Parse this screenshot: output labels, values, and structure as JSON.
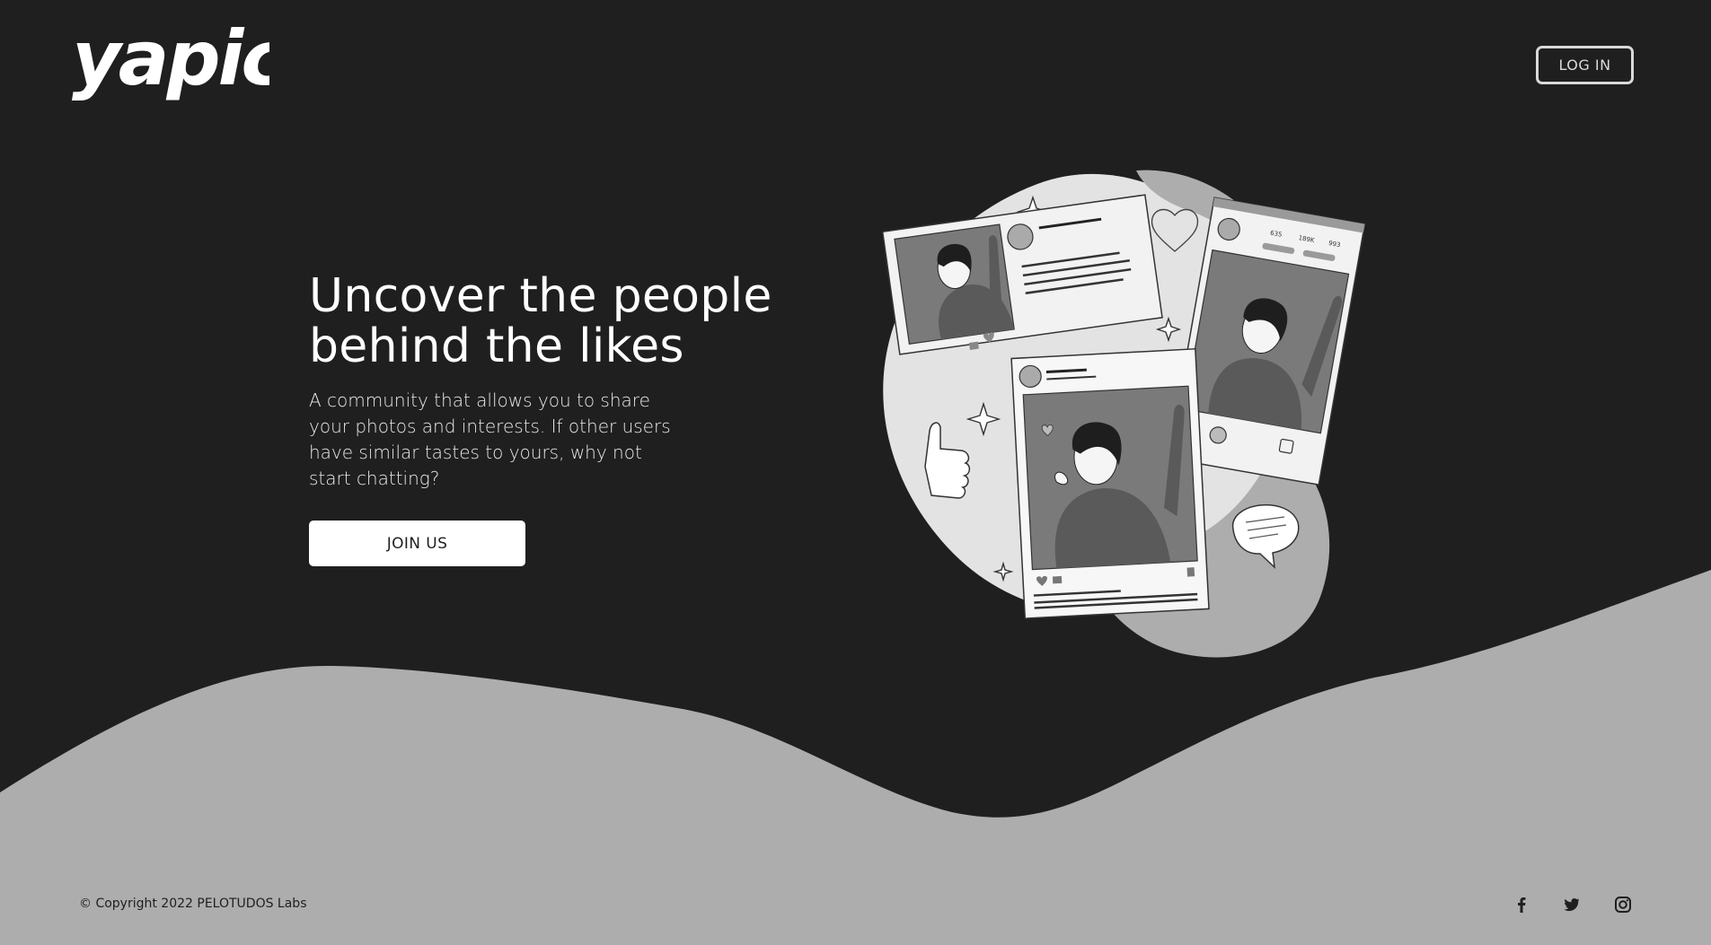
{
  "brand": {
    "logo_text": "yapic"
  },
  "header": {
    "login_label": "LOG IN"
  },
  "hero": {
    "title": "Uncover the people behind the likes",
    "description": "A community that allows you to share your photos and interests. If other users have similar tastes to yours, why not start chatting?",
    "join_label": "JOIN US"
  },
  "illustration": {
    "profile_stats": [
      "635",
      "189K",
      "993"
    ]
  },
  "footer": {
    "copyright": "© Copyright 2022 PELOTUDOS Labs",
    "social_icons": [
      "facebook-icon",
      "twitter-icon",
      "instagram-icon"
    ]
  },
  "colors": {
    "background": "#1f1f1f",
    "wave": "#adadad",
    "button_bg": "#ffffff",
    "text_primary": "#ffffff"
  }
}
